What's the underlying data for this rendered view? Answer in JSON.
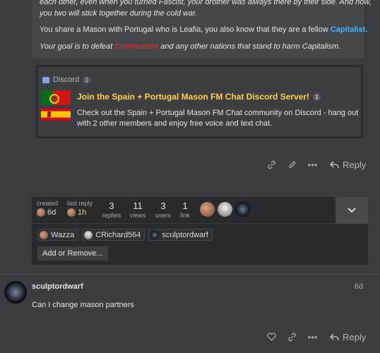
{
  "post1": {
    "line1": "each other, even when you turned Fascist, your brother was always there by their side. And now,",
    "line2": "you two will stick together during the cold war.",
    "line3_pre": "You share a Mason with Portugal who is Leafia, you also know that they are a fellow ",
    "line3_cap": "Capitalist",
    "line3_post": ".",
    "line4_pre": "Your goal is to defeat ",
    "line4_comm": "Communism",
    "line4_post": " and any other nations that stand to harm Capitalism."
  },
  "onebox": {
    "source": "Discord",
    "source_count": "1",
    "title": "Join the Spain + Portugal Mason FM Chat Discord Server!",
    "title_count": "1",
    "description": "Check out the Spain + Portugal Mason FM Chat community on Discord - hang out with 2 other members and enjoy free voice and text chat."
  },
  "post1_actions": {
    "reply_label": "Reply"
  },
  "topic_map": {
    "created_label": "created",
    "created_value": "6d",
    "last_reply_label": "last reply",
    "last_reply_value": "1h",
    "replies_count": "3",
    "replies_label": "replies",
    "views_count": "11",
    "views_label": "views",
    "users_count": "3",
    "users_label": "users",
    "link_count": "1",
    "link_label": "link",
    "participants": [
      "Wazza",
      "CRichard564",
      "sculptordwarf"
    ],
    "add_remove_label": "Add or Remove..."
  },
  "post2": {
    "username": "sculptordwarf",
    "date": "6d",
    "text": "Can I change mason partners",
    "reply_label": "Reply"
  },
  "colors": {
    "capitalist": "#3fb6ff",
    "communism": "#ff2a2a",
    "onebox_title": "#ffd54a"
  }
}
